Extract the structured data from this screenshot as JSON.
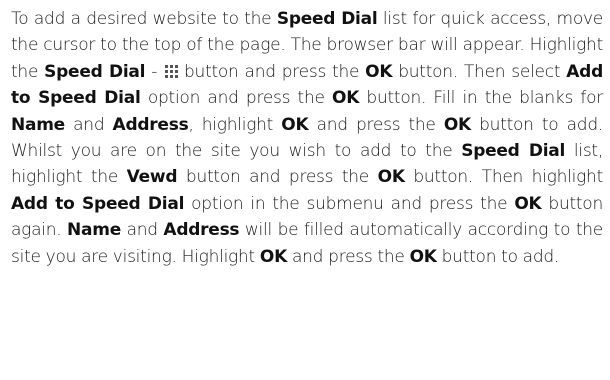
{
  "paragraph": {
    "s1": "To add a desired website to the ",
    "s2": "Speed Dial",
    "s3": " list for quick access, move the cursor to the top of the page. The browser bar will appear. Highlight the ",
    "s4": "Speed Dial",
    "s5": " - ",
    "s6": " button and press the ",
    "s7": "OK",
    "s8": " button. Then select ",
    "s9": "Add to Speed Dial",
    "s10": " option and press the ",
    "s11": "OK",
    "s12": " button. Fill in the blanks for ",
    "s13": "Name",
    "s14": " and ",
    "s15": "Address",
    "s16": ", highlight ",
    "s17": "OK",
    "s18": " and press the ",
    "s19": "OK",
    "s20": " button to add. Whilst you are on the site you wish to add to the ",
    "s21": "Speed Dial",
    "s22": " list, highlight the ",
    "s23": "Vewd",
    "s24": " button and press the ",
    "s25": "OK",
    "s26": " button. Then highlight ",
    "s27": "Add to Speed Dial",
    "s28": " option in the submenu and press the ",
    "s29": "OK",
    "s30": " button again. ",
    "s31": "Name",
    "s32": " and ",
    "s33": "Address",
    "s34": " will be filled automatically according to the site you are visiting. Highlight ",
    "s35": "OK",
    "s36": " and press the ",
    "s37": "OK",
    "s38": " button to add."
  },
  "icons": {
    "speed_dial": "grid-icon",
    "color": "#555555"
  }
}
